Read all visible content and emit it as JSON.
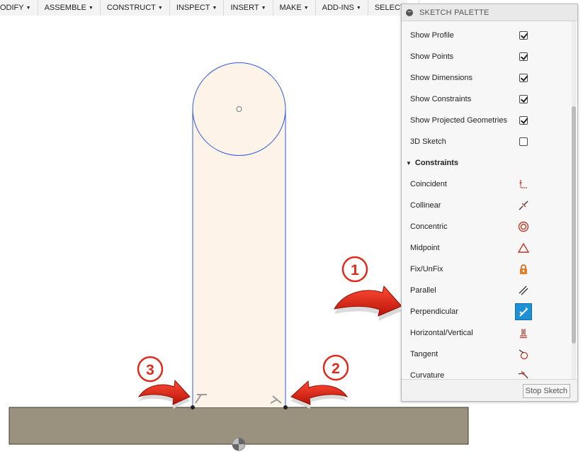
{
  "menu": [
    {
      "label": "ODIFY",
      "name": "menu-modify"
    },
    {
      "label": "ASSEMBLE",
      "name": "menu-assemble"
    },
    {
      "label": "CONSTRUCT",
      "name": "menu-construct"
    },
    {
      "label": "INSPECT",
      "name": "menu-inspect"
    },
    {
      "label": "INSERT",
      "name": "menu-insert"
    },
    {
      "label": "MAKE",
      "name": "menu-make"
    },
    {
      "label": "ADD-INS",
      "name": "menu-add-ins"
    },
    {
      "label": "SELECT",
      "name": "menu-select"
    }
  ],
  "palette": {
    "title": "SKETCH PALETTE",
    "options": [
      {
        "label": "Show Profile",
        "checked": true
      },
      {
        "label": "Show Points",
        "checked": true
      },
      {
        "label": "Show Dimensions",
        "checked": true
      },
      {
        "label": "Show Constraints",
        "checked": true
      },
      {
        "label": "Show Projected Geometries",
        "checked": true
      },
      {
        "label": "3D Sketch",
        "checked": false
      }
    ],
    "constraints_heading": "Constraints",
    "constraints": [
      {
        "label": "Coincident",
        "icon": "coincident-icon"
      },
      {
        "label": "Collinear",
        "icon": "collinear-icon"
      },
      {
        "label": "Concentric",
        "icon": "concentric-icon"
      },
      {
        "label": "Midpoint",
        "icon": "midpoint-icon"
      },
      {
        "label": "Fix/UnFix",
        "icon": "lock-icon"
      },
      {
        "label": "Parallel",
        "icon": "parallel-icon"
      },
      {
        "label": "Perpendicular",
        "icon": "perpendicular-icon",
        "selected": true
      },
      {
        "label": "Horizontal/Vertical",
        "icon": "horizontal-vertical-icon"
      },
      {
        "label": "Tangent",
        "icon": "tangent-icon"
      },
      {
        "label": "Curvature",
        "icon": "curvature-icon"
      }
    ],
    "stop_label": "Stop Sketch"
  },
  "callouts": [
    "1",
    "2",
    "3"
  ],
  "colors": {
    "sketch_line": "#2e5be0",
    "profile_fill": "#fdf3e9",
    "ground": "#9a917f",
    "callout_red": "#e02a1d",
    "selected_icon_bg": "#1e90d6"
  }
}
